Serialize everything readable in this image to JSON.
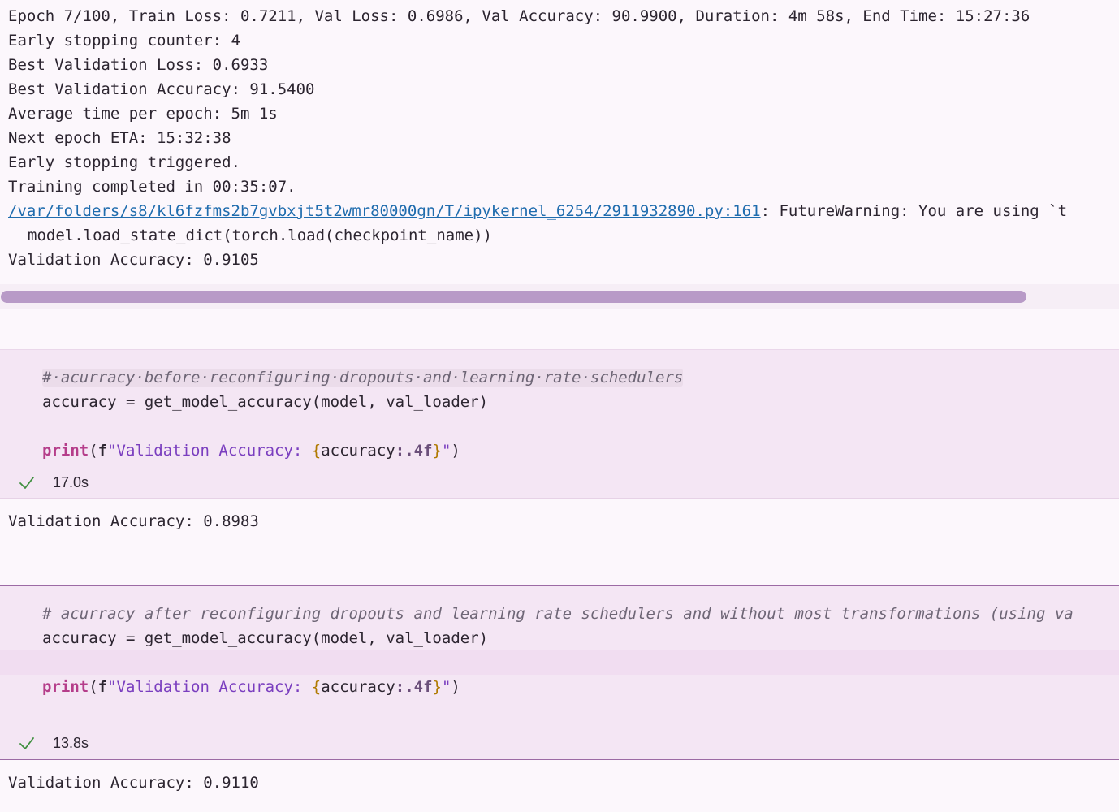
{
  "top_output": {
    "lines": [
      "Epoch 7/100, Train Loss: 0.7211, Val Loss: 0.6986, Val Accuracy: 90.9900, Duration: 4m 58s, End Time: 15:27:36",
      "Early stopping counter: 4",
      "Best Validation Loss: 0.6933",
      "Best Validation Accuracy: 91.5400",
      "Average time per epoch: 5m 1s",
      "Next epoch ETA: 15:32:38",
      "Early stopping triggered.",
      "Training completed in 00:35:07."
    ],
    "warning_path": "/var/folders/s8/kl6fzfms2b7gvbxjt5t2wmr80000gn/T/ipykernel_6254/2911932890.py:161",
    "warning_text": ": FutureWarning: You are using `t",
    "warning_code": "model.load_state_dict(torch.load(checkpoint_name))",
    "final_line": "Validation Accuracy: 0.9105"
  },
  "cell1": {
    "comment": "#·acurracy·before·reconfiguring·dropouts·and·learning·rate·schedulers",
    "line2": "accuracy = get_model_accuracy(model, val_loader)",
    "print_kw": "print",
    "open_paren": "(",
    "f_prefix": "f",
    "str_open": "\"Validation Accuracy: ",
    "brace_open": "{",
    "expr": "accuracy",
    "fmt": ":.4f",
    "brace_close": "}",
    "str_close": "\"",
    "close_paren": ")",
    "duration": "17.0s",
    "output": "Validation Accuracy: 0.8983"
  },
  "cell2": {
    "comment": "# acurracy after reconfiguring dropouts and learning rate schedulers and without most transformations (using va",
    "line2": "accuracy = get_model_accuracy(model, val_loader)",
    "print_kw": "print",
    "open_paren": "(",
    "f_prefix": "f",
    "str_open": "\"Validation Accuracy: ",
    "brace_open": "{",
    "expr": "accuracy",
    "fmt": ":.4f",
    "brace_close": "}",
    "str_close": "\"",
    "close_paren": ")",
    "duration": "13.8s",
    "output": "Validation Accuracy: 0.9110"
  },
  "icons": {
    "status": "check-icon"
  },
  "colors": {
    "accent": "#9c6aa4",
    "link": "#1f6cae",
    "success": "#3f8f3f"
  }
}
